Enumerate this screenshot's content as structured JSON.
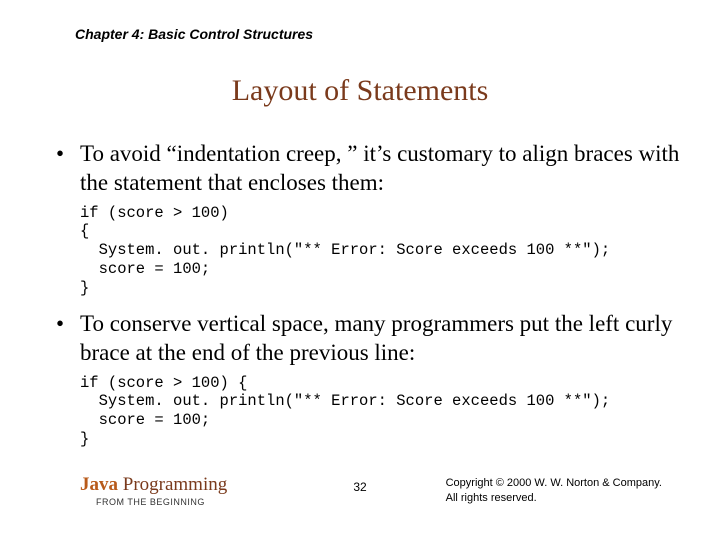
{
  "chapter": "Chapter 4: Basic Control Structures",
  "title": "Layout of Statements",
  "bullets": [
    "To avoid “indentation creep, ” it’s customary to align braces with the statement that encloses them:",
    "To conserve vertical space, many programmers put the left curly brace at the end of the previous line:"
  ],
  "code": [
    "if (score > 100)\n{\n  System. out. println(\"** Error: Score exceeds 100 **\");\n  score = 100;\n}",
    "if (score > 100) {\n  System. out. println(\"** Error: Score exceeds 100 **\");\n  score = 100;\n}"
  ],
  "footer": {
    "java": "Java",
    "programming": " Programming",
    "subtitle": "FROM THE BEGINNING",
    "page": "32",
    "copyright1": "Copyright © 2000 W. W. Norton & Company.",
    "copyright2": "All rights reserved."
  }
}
